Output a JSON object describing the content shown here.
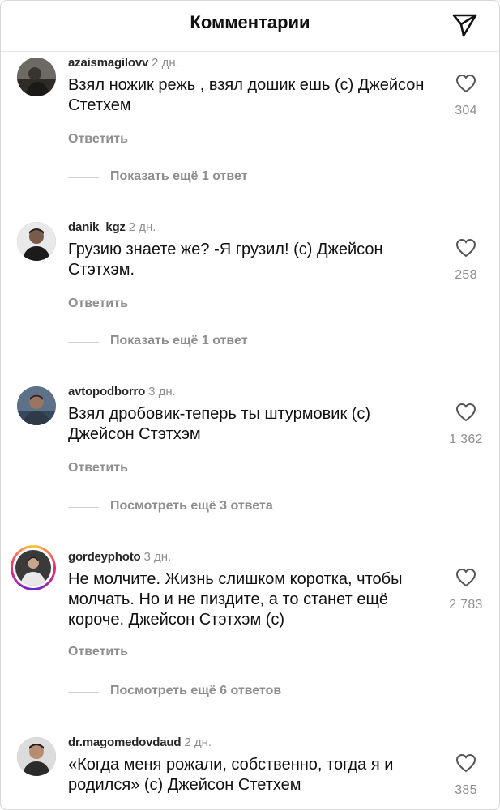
{
  "header": {
    "title": "Комментарии",
    "send_icon": "paper-plane-icon"
  },
  "comments": [
    {
      "username": "azaismagilovv",
      "time": "2 дн.",
      "text": "Взял ножик режь , взял дошик ешь (с) Джейсон Стетхем",
      "likes": "304",
      "reply_label": "Ответить",
      "more_label": "Показать ещё 1 ответ"
    },
    {
      "username": "danik_kgz",
      "time": "2 дн.",
      "text": "Грузию знаете же? -Я грузил! (с) Джейсон Стэтхэм.",
      "likes": "258",
      "reply_label": "Ответить",
      "more_label": "Показать ещё 1 ответ"
    },
    {
      "username": "avtopodborro",
      "time": "3 дн.",
      "text": "Взял дробовик-теперь ты штурмовик (с) Джейсон Стэтхэм",
      "likes": "1 362",
      "reply_label": "Ответить",
      "more_label": "Посмотреть ещё 3 ответа"
    },
    {
      "username": "gordeyphoto",
      "time": "3 дн.",
      "text": "Не молчите. Жизнь слишком коротка, чтобы молчать. Но и не пиздите, а то станет ещё короче. Джейсон Стэтхэм (с)",
      "likes": "2 783",
      "reply_label": "Ответить",
      "more_label": "Посмотреть ещё 6 ответов"
    },
    {
      "username": "dr.magomedovdaud",
      "time": "2 дн.",
      "text": "«Когда меня рожали, собственно, тогда я и родился» (с) Джейсон Стетхем",
      "likes": "385"
    }
  ],
  "colors": {
    "muted": "#8e8e8e",
    "text": "#111111",
    "story_ring": "#ee2a7b"
  }
}
